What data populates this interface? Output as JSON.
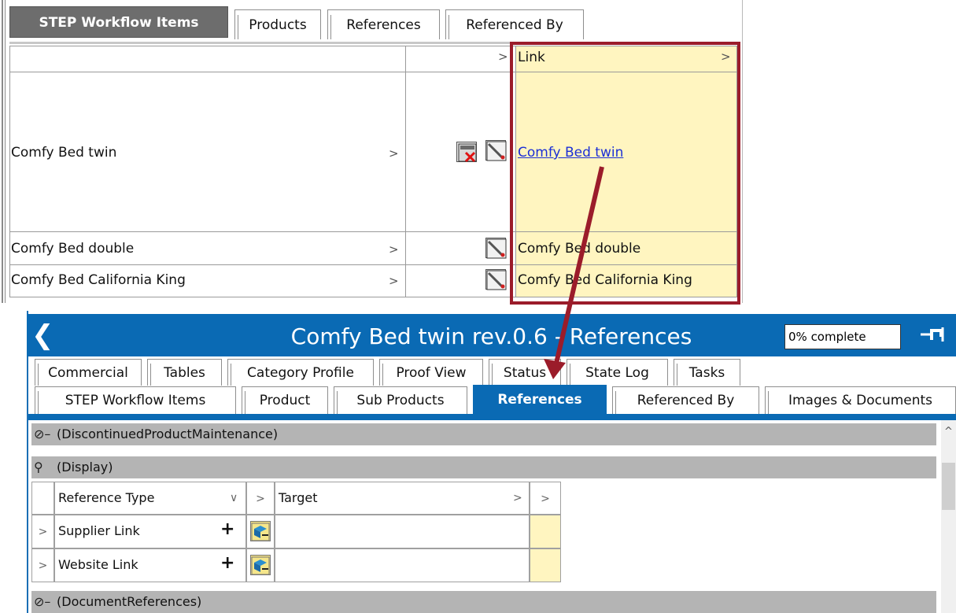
{
  "top_panel": {
    "tabs": [
      {
        "label": "STEP Workflow Items",
        "active": true
      },
      {
        "label": "Products",
        "active": false
      },
      {
        "label": "References",
        "active": false
      },
      {
        "label": "Referenced By",
        "active": false
      }
    ],
    "grid": {
      "header": {
        "col3": "Link"
      },
      "rows": [
        {
          "name": "Comfy Bed twin",
          "link": "Comfy Bed twin",
          "is_link": true
        },
        {
          "name": "Comfy Bed double",
          "link": "Comfy Bed double",
          "is_link": false
        },
        {
          "name": "Comfy Bed California King",
          "link": "Comfy Bed California King",
          "is_link": false
        }
      ]
    },
    "highlight_color": "#fff5c0",
    "callout_color": "#9b1c2a"
  },
  "window": {
    "title": "Comfy Bed twin rev.0.6 - References",
    "back_icon": "back-chevron-icon",
    "progress_text": "0% complete",
    "pin_icon": "pin-icon",
    "accent": "#0a6ab4",
    "tabs_row1": [
      "Commercial",
      "Tables",
      "Category Profile",
      "Proof View",
      "Status",
      "State Log",
      "Tasks"
    ],
    "tabs_row2": [
      "STEP Workflow Items",
      "Product",
      "Sub Products",
      "References",
      "Referenced By",
      "Images & Documents"
    ],
    "active_tab": "References",
    "groups": {
      "g1": "(DiscontinuedProductMaintenance)",
      "g2": "(Display)",
      "g3": "(DocumentReferences)"
    },
    "ref_table": {
      "col_type": "Reference Type",
      "col_target": "Target",
      "rows": [
        "Supplier Link",
        "Website Link"
      ]
    }
  }
}
